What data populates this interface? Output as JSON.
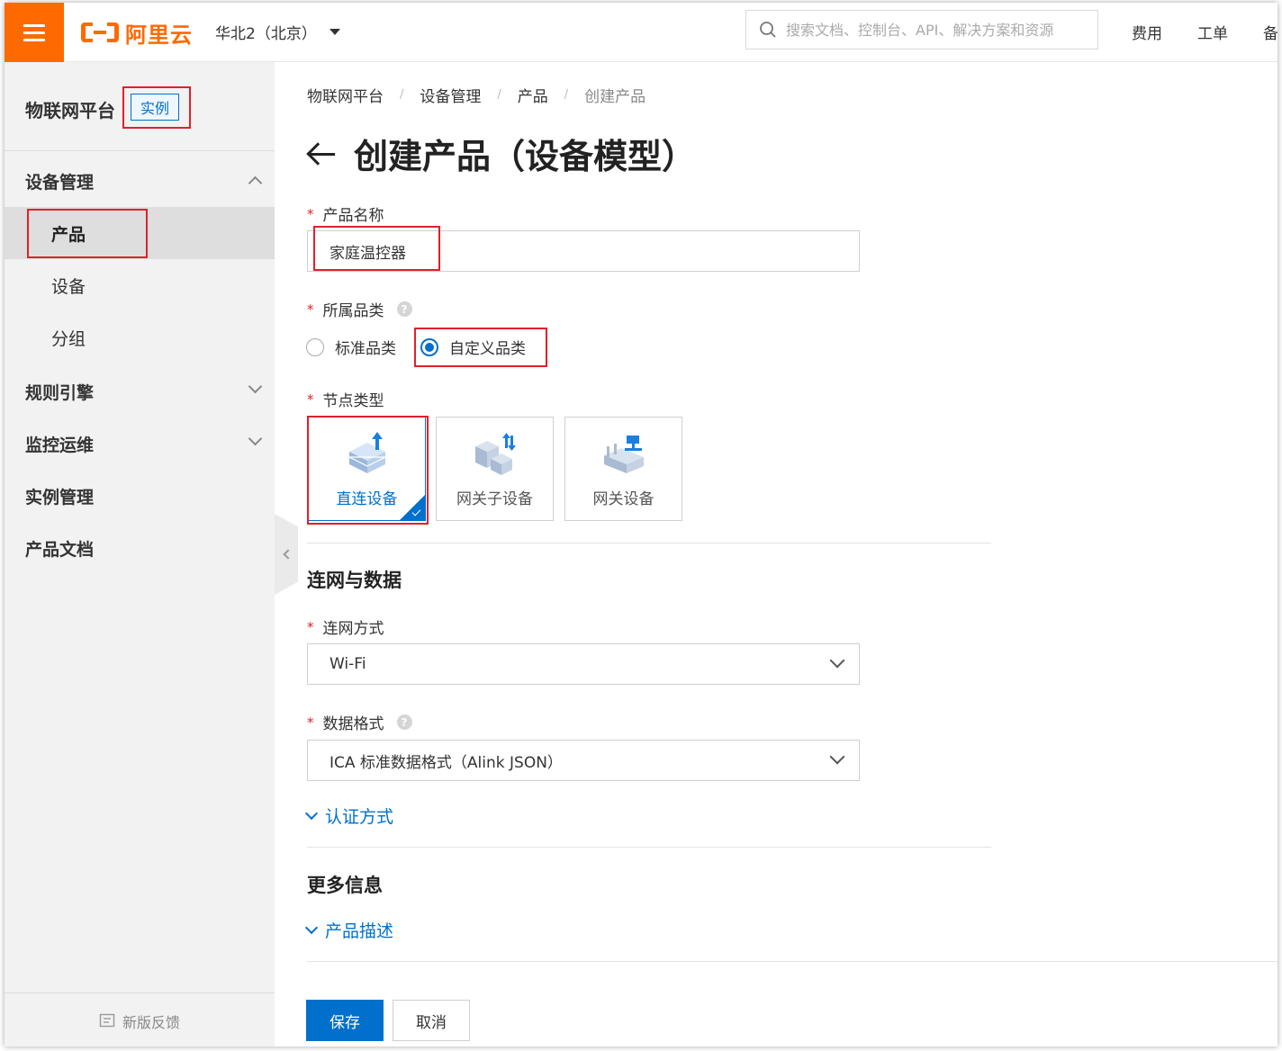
{
  "topbar": {
    "logo_text": "阿里云",
    "region": "华北2（北京）",
    "search_placeholder": "搜索文档、控制台、API、解决方案和资源",
    "links": [
      "费用",
      "工单",
      "备"
    ]
  },
  "sidebar": {
    "title": "物联网平台",
    "badge": "实例",
    "items": [
      {
        "label": "设备管理",
        "type": "group",
        "expanded": true
      },
      {
        "label": "产品",
        "type": "sub",
        "active": true
      },
      {
        "label": "设备",
        "type": "sub"
      },
      {
        "label": "分组",
        "type": "sub"
      },
      {
        "label": "规则引擎",
        "type": "group",
        "expanded": false
      },
      {
        "label": "监控运维",
        "type": "group",
        "expanded": false
      },
      {
        "label": "实例管理",
        "type": "group"
      },
      {
        "label": "产品文档",
        "type": "group"
      }
    ],
    "feedback": "新版反馈"
  },
  "breadcrumb": [
    "物联网平台",
    "设备管理",
    "产品",
    "创建产品"
  ],
  "page_title": "创建产品（设备模型）",
  "form": {
    "product_name": {
      "label": "产品名称",
      "value": "家庭温控器"
    },
    "category": {
      "label": "所属品类",
      "options": [
        "标准品类",
        "自定义品类"
      ],
      "selected": "自定义品类"
    },
    "node_type": {
      "label": "节点类型",
      "options": [
        "直连设备",
        "网关子设备",
        "网关设备"
      ],
      "selected": "直连设备"
    },
    "section_network": "连网与数据",
    "network_method": {
      "label": "连网方式",
      "value": "Wi-Fi"
    },
    "data_format": {
      "label": "数据格式",
      "value": "ICA 标准数据格式（Alink JSON）"
    },
    "auth_expander": "认证方式",
    "section_more": "更多信息",
    "desc_expander": "产品描述"
  },
  "buttons": {
    "save": "保存",
    "cancel": "取消"
  },
  "colors": {
    "brand": "#ff6a00",
    "primary": "#0070cc",
    "highlight_box": "#e0202b"
  }
}
